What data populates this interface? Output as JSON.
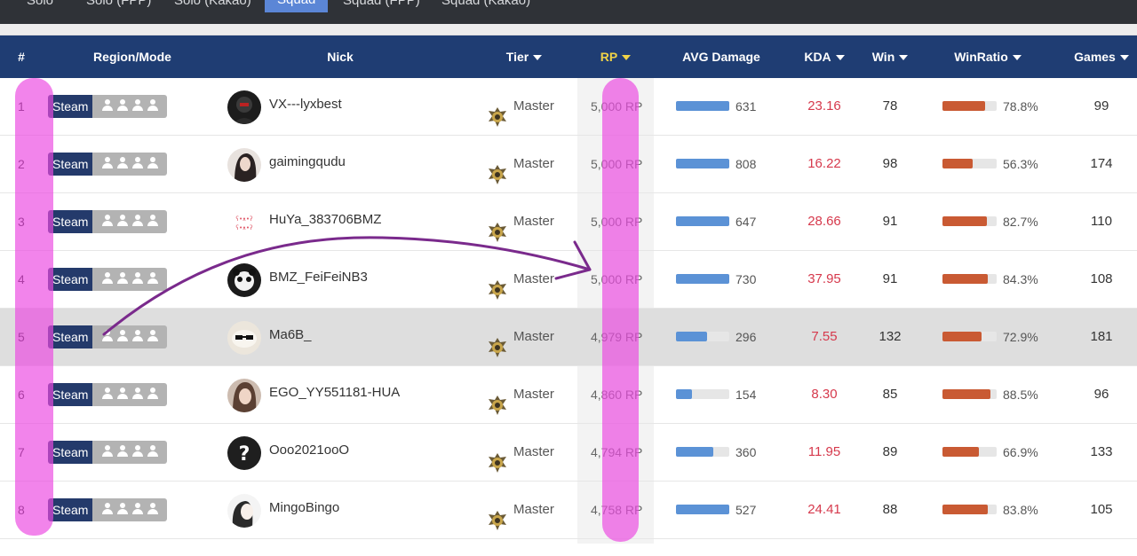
{
  "mode_tabs": [
    {
      "label": "Solo",
      "active": false
    },
    {
      "label": "Solo (FPP)",
      "active": false
    },
    {
      "label": "Solo (Kakao)",
      "active": false
    },
    {
      "label": "Squad",
      "active": true
    },
    {
      "label": "Squad (FPP)",
      "active": false
    },
    {
      "label": "Squad (Kakao)",
      "active": false
    }
  ],
  "headers": {
    "rank": "#",
    "region_mode": "Region/Mode",
    "nick": "Nick",
    "tier": "Tier",
    "rp": "RP",
    "avg_damage": "AVG Damage",
    "kda": "KDA",
    "win": "Win",
    "win_ratio": "WinRatio",
    "games": "Games"
  },
  "colors": {
    "header_bg": "#1f3d73",
    "sort_active": "#f0d347",
    "damage_bar": "#5b92d6",
    "win_ratio_bar": "#c95a33",
    "kda_text": "#d6394c",
    "highlight_annotation": "#ec4ae2",
    "arrow_annotation": "#7a2a8c"
  },
  "rows": [
    {
      "rank": "1",
      "region": "Steam",
      "mode_icon": "squad-icon",
      "nick": "VX---lyxbest",
      "tier": "Master",
      "rp": "5,000 RP",
      "avg_damage": "631",
      "damage_fill": 1.0,
      "kda": "23.16",
      "win": "78",
      "win_ratio": "78.8%",
      "win_ratio_fill": 0.788,
      "games": "99",
      "avatar": "avatar-dark"
    },
    {
      "rank": "2",
      "region": "Steam",
      "mode_icon": "squad-icon",
      "nick": "gaimingqudu",
      "tier": "Master",
      "rp": "5,000 RP",
      "avg_damage": "808",
      "damage_fill": 1.0,
      "kda": "16.22",
      "win": "98",
      "win_ratio": "56.3%",
      "win_ratio_fill": 0.563,
      "games": "174",
      "avatar": "avatar-portrait"
    },
    {
      "rank": "3",
      "region": "Steam",
      "mode_icon": "squad-icon",
      "nick": "HuYa_383706BMZ",
      "tier": "Master",
      "rp": "5,000 RP",
      "avg_damage": "647",
      "damage_fill": 1.0,
      "kda": "28.66",
      "win": "91",
      "win_ratio": "82.7%",
      "win_ratio_fill": 0.827,
      "games": "110",
      "avatar": "avatar-text"
    },
    {
      "rank": "4",
      "region": "Steam",
      "mode_icon": "squad-icon",
      "nick": "BMZ_FeiFeiNB3",
      "tier": "Master",
      "rp": "5,000 RP",
      "avg_damage": "730",
      "damage_fill": 1.0,
      "kda": "37.95",
      "win": "91",
      "win_ratio": "84.3%",
      "win_ratio_fill": 0.843,
      "games": "108",
      "avatar": "avatar-panda"
    },
    {
      "rank": "5",
      "region": "Steam",
      "mode_icon": "squad-icon",
      "nick": "Ma6B_",
      "tier": "Master",
      "rp": "4,979 RP",
      "avg_damage": "296",
      "damage_fill": 0.58,
      "kda": "7.55",
      "win": "132",
      "win_ratio": "72.9%",
      "win_ratio_fill": 0.729,
      "games": "181",
      "avatar": "avatar-meme",
      "highlighted": true
    },
    {
      "rank": "6",
      "region": "Steam",
      "mode_icon": "squad-icon",
      "nick": "EGO_YY551181-HUA",
      "tier": "Master",
      "rp": "4,860 RP",
      "avg_damage": "154",
      "damage_fill": 0.3,
      "kda": "8.30",
      "win": "85",
      "win_ratio": "88.5%",
      "win_ratio_fill": 0.885,
      "games": "96",
      "avatar": "avatar-girl"
    },
    {
      "rank": "7",
      "region": "Steam",
      "mode_icon": "squad-icon",
      "nick": "Ooo2021ooO",
      "tier": "Master",
      "rp": "4,794 RP",
      "avg_damage": "360",
      "damage_fill": 0.7,
      "kda": "11.95",
      "win": "89",
      "win_ratio": "66.9%",
      "win_ratio_fill": 0.669,
      "games": "133",
      "avatar": "avatar-question"
    },
    {
      "rank": "8",
      "region": "Steam",
      "mode_icon": "squad-icon",
      "nick": "MingoBingo",
      "tier": "Master",
      "rp": "4,758 RP",
      "avg_damage": "527",
      "damage_fill": 1.0,
      "kda": "24.41",
      "win": "88",
      "win_ratio": "83.8%",
      "win_ratio_fill": 0.838,
      "games": "105",
      "avatar": "avatar-white"
    }
  ]
}
